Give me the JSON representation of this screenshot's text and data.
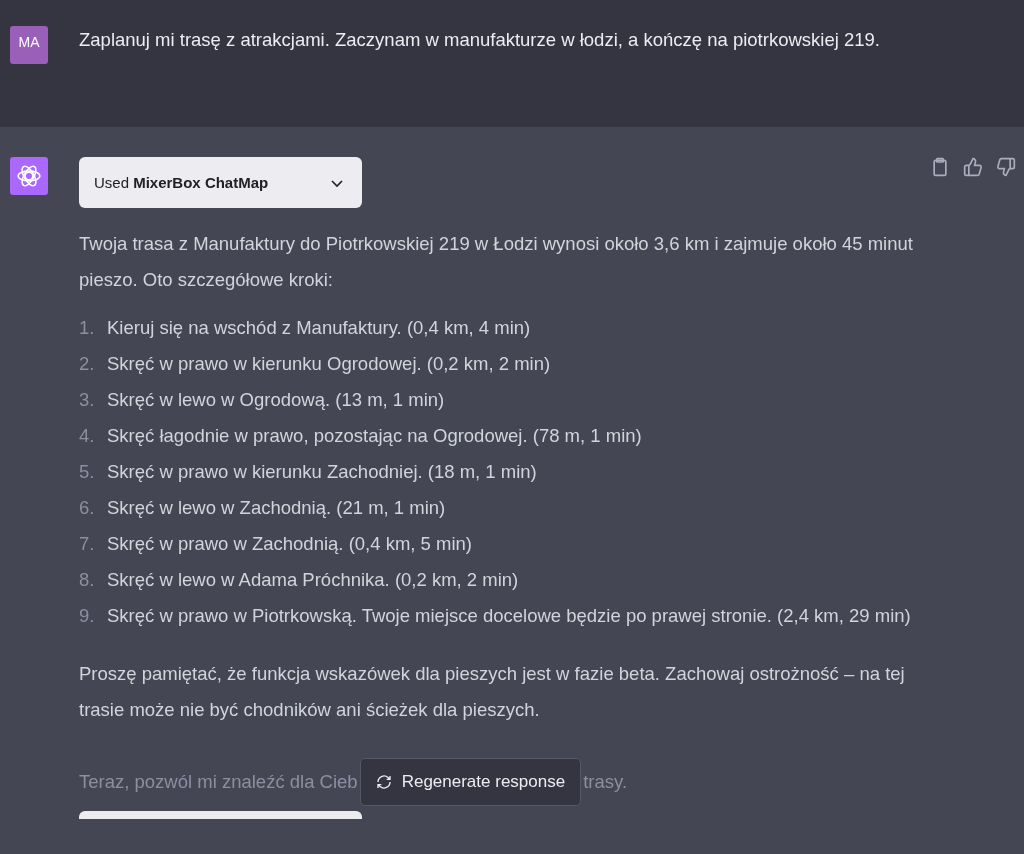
{
  "user_message": {
    "avatar": "MA",
    "text": "Zaplanuj mi trasę z atrakcjami. Zaczynam w manufakturze w łodzi, a kończę na piotrkowskiej 219."
  },
  "assistant_message": {
    "plugin": {
      "label": "Used **MixerBox ChatMap**",
      "expanded": false
    },
    "intro": "Twoja trasa z Manufaktury do Piotrkowskiej 219 w Łodzi wynosi około 3,6 km i zajmuje około 45 minut pieszo. Oto szczegółowe kroki:",
    "steps": [
      {
        "number": "1.",
        "text": "Kieruj się na wschód z Manufaktury. (0,4 km, 4 min)"
      },
      {
        "number": "2.",
        "text": "Skręć w prawo w kierunku Ogrodowej. (0,2 km, 2 min)"
      },
      {
        "number": "3.",
        "text": "Skręć w lewo w Ogrodową. (13 m, 1 min)"
      },
      {
        "number": "4.",
        "text": "Skręć łagodnie w prawo, pozostając na Ogrodowej. (78 m, 1 min)"
      },
      {
        "number": "5.",
        "text": "Skręć w prawo w kierunku Zachodniej. (18 m, 1 min)"
      },
      {
        "number": "6.",
        "text": "Skręć w lewo w Zachodnią. (21 m, 1 min)"
      },
      {
        "number": "7.",
        "text": "Skręć w prawo w Zachodnią. (0,4 km, 5 min)"
      },
      {
        "number": "8.",
        "text": "Skręć w lewo w Adama Próchnika. (0,2 km, 2 min)"
      },
      {
        "number": "9.",
        "text": "Skręć w prawo w Piotrkowską. Twoje miejsce docelowe będzie po prawej stronie. (2,4 km, 29 min)"
      }
    ],
    "note": "Proszę pamiętać, że funkcja wskazówek dla pieszych jest w fazie beta. Zachowaj ostrożność – na tej trasie może nie być chodników ani ścieżek dla pieszych.",
    "partial_before": "Teraz, pozwól mi znaleźć dla Cieb",
    "partial_after": "trasy."
  },
  "regenerate_button": {
    "label": "Regenerate response"
  }
}
